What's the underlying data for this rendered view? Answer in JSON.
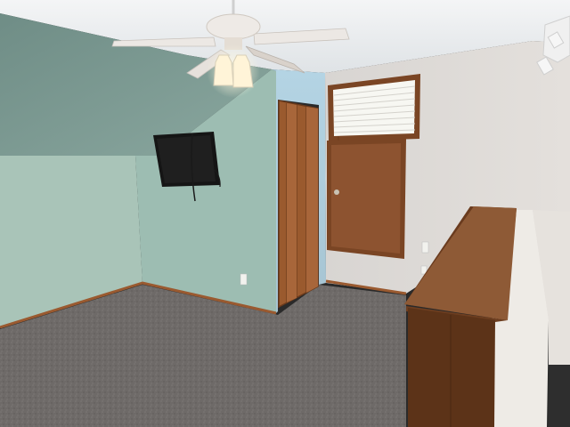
{
  "scene": {
    "description_free": true,
    "colors": {
      "ceiling": "#eef0f2",
      "sloped_ceiling": "#7d9a92",
      "left_wall": "#a9c4b8",
      "center_wall": "#9dbdb2",
      "blue_wall": "#a8c8d8",
      "right_wall": "#dcd8d4",
      "carpet": "#6e6a68",
      "wood": "#8a4f2a",
      "wood_dark": "#5c3318",
      "trim": "#9a5a30",
      "tv": "#151515",
      "railing_top": "#8e5a36"
    },
    "objects": [
      "ceiling-fan",
      "wall-mounted-tv",
      "bifold-closet-door",
      "small-wooden-door",
      "window-with-blinds",
      "wooden-half-wall-railing",
      "track-light"
    ]
  }
}
